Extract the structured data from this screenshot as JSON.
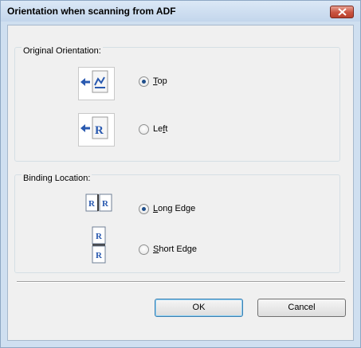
{
  "dialog": {
    "title": "Orientation when scanning from ADF",
    "close_icon": "close-icon"
  },
  "original_orientation": {
    "group_label": "Original Orientation:",
    "options": [
      {
        "label_mnemonic": "T",
        "label_rest": "op",
        "selected": true,
        "icon": "feed-top-icon"
      },
      {
        "label_before": "Le",
        "label_mnemonic": "f",
        "label_rest": "t",
        "selected": false,
        "icon": "feed-left-icon"
      }
    ]
  },
  "binding_location": {
    "group_label": "Binding Location:",
    "options": [
      {
        "label_mnemonic": "L",
        "label_rest": "ong Edge",
        "selected": true,
        "icon": "long-edge-binding-icon"
      },
      {
        "label_mnemonic": "S",
        "label_rest": "hort Edge",
        "selected": false,
        "icon": "short-edge-binding-icon"
      }
    ]
  },
  "buttons": {
    "ok": "OK",
    "cancel": "Cancel"
  },
  "icon_glyph": "R",
  "colors": {
    "accent_blue": "#2a5ab0",
    "radio_dot": "#1f4e8a"
  }
}
